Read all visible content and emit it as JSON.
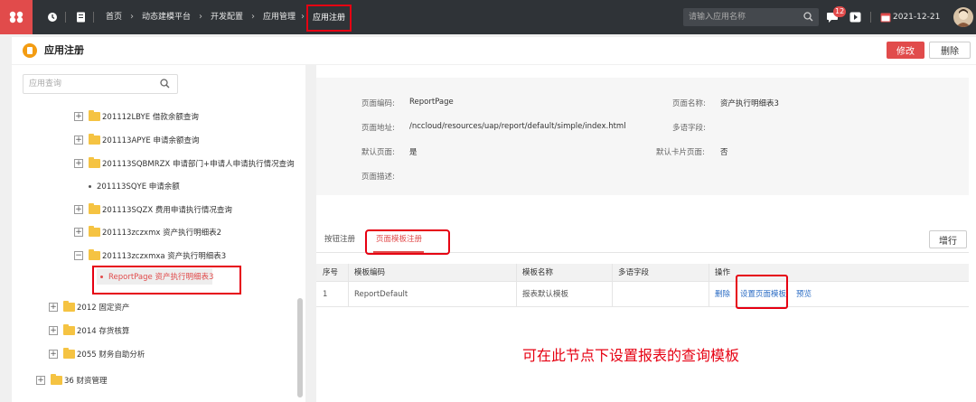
{
  "topbar": {
    "breadcrumb": [
      "首页",
      "动态建模平台",
      "开发配置",
      "应用管理"
    ],
    "active_crumb": "应用注册",
    "search_placeholder": "请输入应用名称",
    "notification_count": "12",
    "date": "2021-12-21"
  },
  "header": {
    "title": "应用注册",
    "edit_label": "修改",
    "delete_label": "删除"
  },
  "tree": {
    "search_placeholder": "应用查询",
    "items": [
      {
        "label": "201112LBYE 借款余额查询",
        "type": "folder",
        "expander": "+"
      },
      {
        "label": "201113APYE 申请余额查询",
        "type": "folder",
        "expander": "+"
      },
      {
        "label": "201113SQBMRZX 申请部门+申请人申请执行情况查询",
        "type": "folder",
        "expander": "+"
      },
      {
        "label": "201113SQYE 申请余额",
        "type": "leaf"
      },
      {
        "label": "201113SQZX 费用申请执行情况查询",
        "type": "folder",
        "expander": "+"
      },
      {
        "label": "201113zczxmx 资产执行明细表2",
        "type": "folder",
        "expander": "+"
      },
      {
        "label": "201113zczxmxa 资产执行明细表3",
        "type": "folder",
        "expander": "−"
      },
      {
        "label": "ReportPage 资产执行明细表3",
        "type": "leaf",
        "selected": true
      },
      {
        "label": "2012 固定资产",
        "type": "folder",
        "expander": "+"
      },
      {
        "label": "2014 存货核算",
        "type": "folder",
        "expander": "+"
      },
      {
        "label": "2055 财务自助分析",
        "type": "folder",
        "expander": "+"
      },
      {
        "label": "36 财资管理",
        "type": "folder",
        "expander": "+"
      }
    ]
  },
  "detail": {
    "page_code_label": "页面编码:",
    "page_code": "ReportPage",
    "page_name_label": "页面名称:",
    "page_name": "资产执行明细表3",
    "page_url_label": "页面地址:",
    "page_url": "/nccloud/resources/uap/report/default/simple/index.html",
    "multilang_label": "多语字段:",
    "default_page_label": "默认页面:",
    "default_page": "是",
    "default_card_label": "默认卡片页面:",
    "default_card": "否",
    "desc_label": "页面描述:"
  },
  "tabs": {
    "button_reg": "按钮注册",
    "template_reg": "页面模板注册",
    "add_row": "增行"
  },
  "table": {
    "headers": [
      "序号",
      "模板编码",
      "模板名称",
      "多语字段",
      "操作"
    ],
    "rows": [
      {
        "index": "1",
        "code": "ReportDefault",
        "name": "报表默认模板",
        "multilang": "",
        "ops": [
          "删除",
          "设置页面模板",
          "预览"
        ]
      }
    ]
  },
  "annotation": "可在此节点下设置报表的查询模板",
  "colors": {
    "accent": "#e14b4b",
    "highlight": "#e60012",
    "link": "#2b6cc4",
    "topbar": "#2f3337"
  }
}
